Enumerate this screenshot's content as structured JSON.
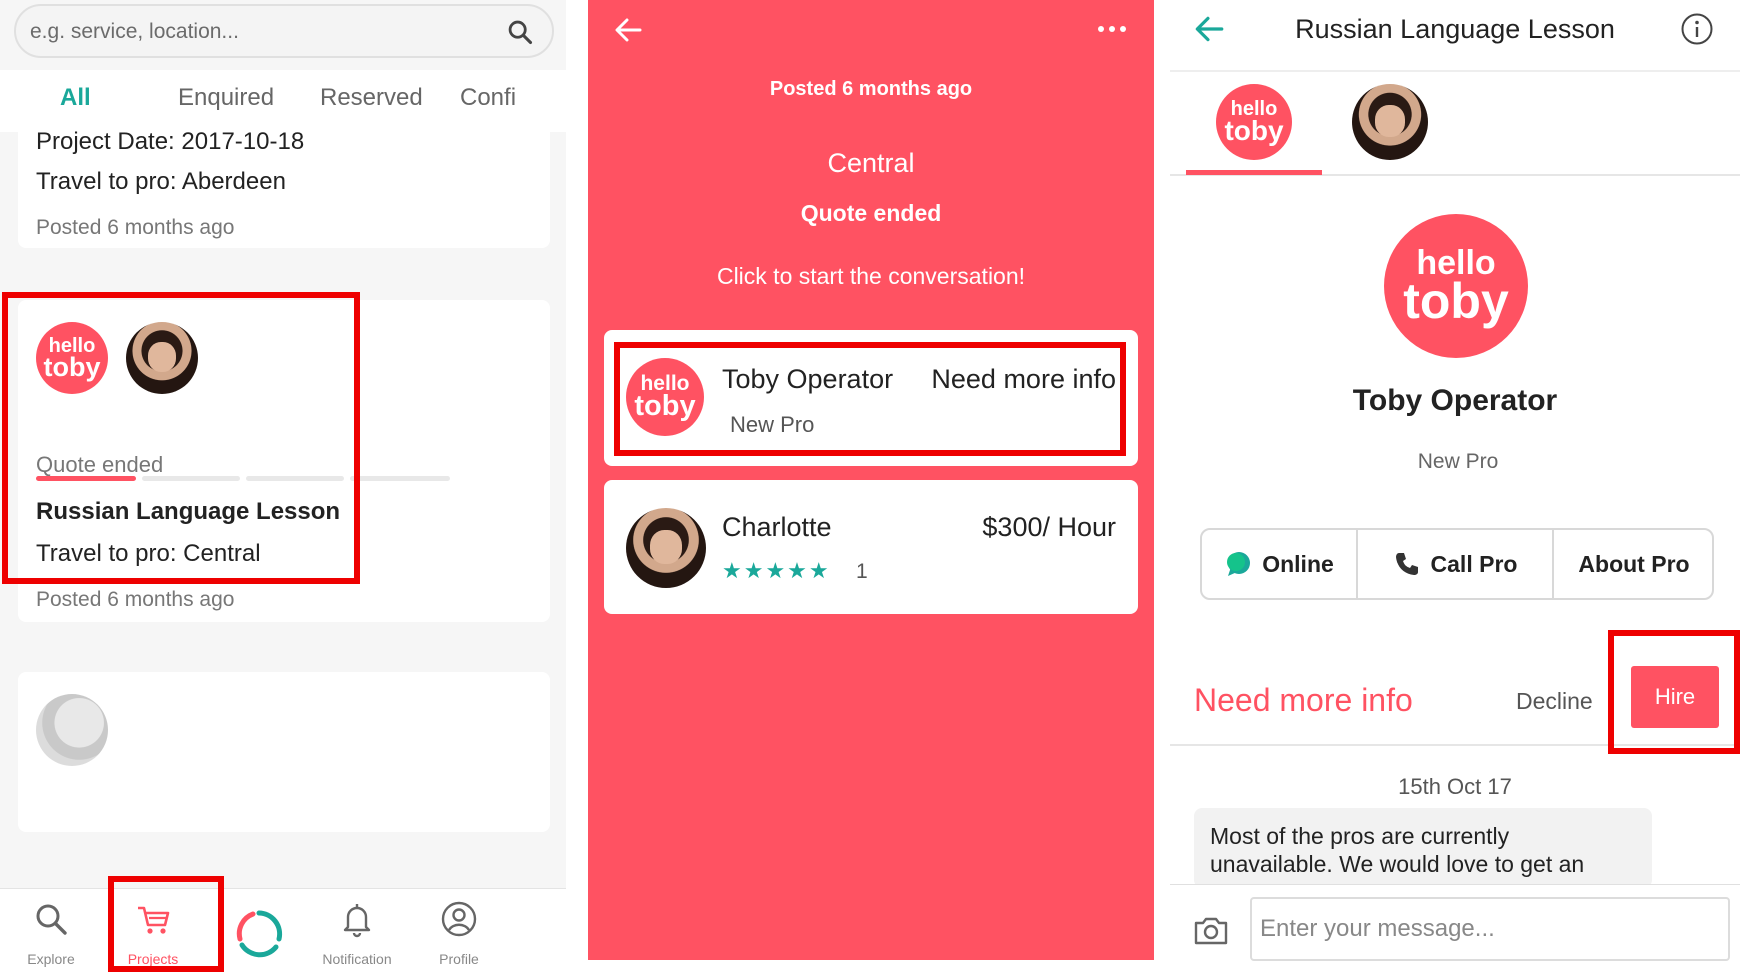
{
  "panel1": {
    "search": {
      "placeholder": "e.g. service, location..."
    },
    "tabs": [
      "All",
      "Enquired",
      "Reserved",
      "Confi"
    ],
    "card1": {
      "project_date": "Project Date: 2017-10-18",
      "travel": "Travel to pro: Aberdeen",
      "posted": "Posted 6 months ago"
    },
    "card2": {
      "logo_top": "hello",
      "logo_bottom": "toby",
      "status": "Quote ended",
      "title": "Russian Language Lesson",
      "travel": "Travel to pro: Central",
      "posted": "Posted 6 months ago",
      "progress_step": 1,
      "progress_steps": 4
    },
    "nav": [
      {
        "label": "Explore",
        "icon": "search-icon"
      },
      {
        "label": "Projects",
        "icon": "cart-icon"
      },
      {
        "label": "",
        "icon": "loading-ring-icon"
      },
      {
        "label": "Notification",
        "icon": "bell-icon"
      },
      {
        "label": "Profile",
        "icon": "profile-icon"
      }
    ]
  },
  "panel2": {
    "posted": "Posted 6 months ago",
    "location": "Central",
    "status": "Quote ended",
    "prompt": "Click to start the conversation!",
    "pros": [
      {
        "name": "Toby Operator",
        "subtitle": "New Pro",
        "right": "Need more info",
        "logo_top": "hello",
        "logo_bottom": "toby"
      },
      {
        "name": "Charlotte",
        "stars": "★★★★★",
        "review_count": "1",
        "right": "$300/ Hour"
      }
    ]
  },
  "panel3": {
    "title": "Russian Language Lesson",
    "logo_top": "hello",
    "logo_bottom": "toby",
    "pro_name": "Toby Operator",
    "pro_subtitle": "New Pro",
    "segments": [
      "Online",
      "Call Pro",
      "About Pro"
    ],
    "status": "Need more info",
    "decline": "Decline",
    "hire": "Hire",
    "date": "15th Oct 17",
    "message": "Most of the pros are currently unavailable. We would love to get an",
    "input_placeholder": "Enter your message..."
  },
  "colors": {
    "brand": "#ff5262",
    "accent": "#1aa89a",
    "highlight": "#ee0000"
  }
}
